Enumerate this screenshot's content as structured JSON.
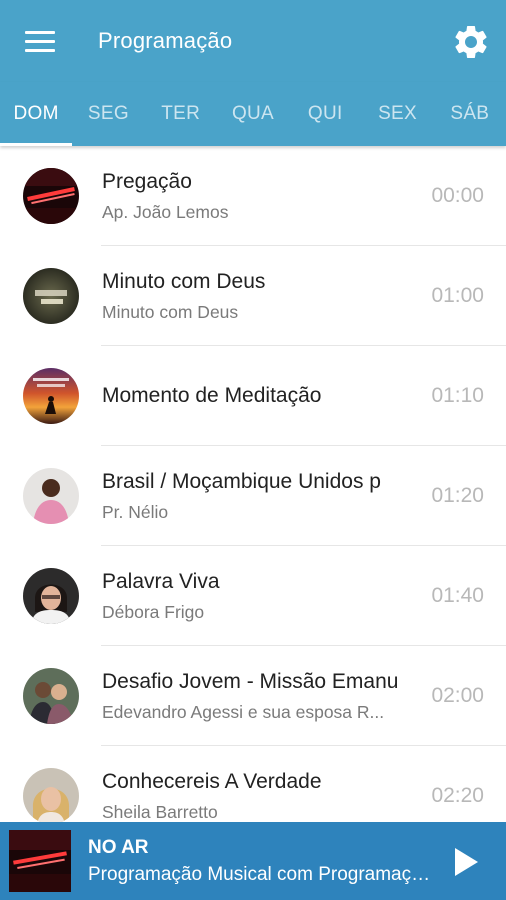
{
  "app": {
    "title": "Programação",
    "header_color": "#4aa3c9",
    "player_color": "#2e83bc"
  },
  "tabs": [
    {
      "label": "DOM",
      "active": true
    },
    {
      "label": "SEG",
      "active": false
    },
    {
      "label": "TER",
      "active": false
    },
    {
      "label": "QUA",
      "active": false
    },
    {
      "label": "QUI",
      "active": false
    },
    {
      "label": "SEX",
      "active": false
    },
    {
      "label": "SÁB",
      "active": false
    }
  ],
  "schedule": [
    {
      "title": "Pregação",
      "subtitle": "Ap. João Lemos",
      "time": "00:00",
      "avatar": "neon-sign-image"
    },
    {
      "title": "Minuto com Deus",
      "subtitle": "Minuto com Deus",
      "time": "01:00",
      "avatar": "minuto-com-deus-logo"
    },
    {
      "title": "Momento de Meditação",
      "subtitle": "",
      "time": "01:10",
      "avatar": "sunset-prayer-image"
    },
    {
      "title": "Brasil / Moçambique Unidos p",
      "subtitle": "Pr. Nélio",
      "time": "01:20",
      "avatar": "man-pink-shirt-photo"
    },
    {
      "title": "Palavra Viva",
      "subtitle": "Débora Frigo",
      "time": "01:40",
      "avatar": "woman-glasses-photo"
    },
    {
      "title": "Desafio Jovem - Missão Emanu",
      "subtitle": "Edevandro Agessi e sua esposa R...",
      "time": "02:00",
      "avatar": "couple-photo"
    },
    {
      "title": "Conhecereis A Verdade",
      "subtitle": "Sheila Barretto",
      "time": "02:20",
      "avatar": "blonde-woman-photo"
    }
  ],
  "player": {
    "status_label": "NO AR",
    "program": "Programação Musical com Programação Musical",
    "play_icon": "play-icon"
  },
  "icons": {
    "menu": "menu-icon",
    "settings": "gear-icon"
  }
}
